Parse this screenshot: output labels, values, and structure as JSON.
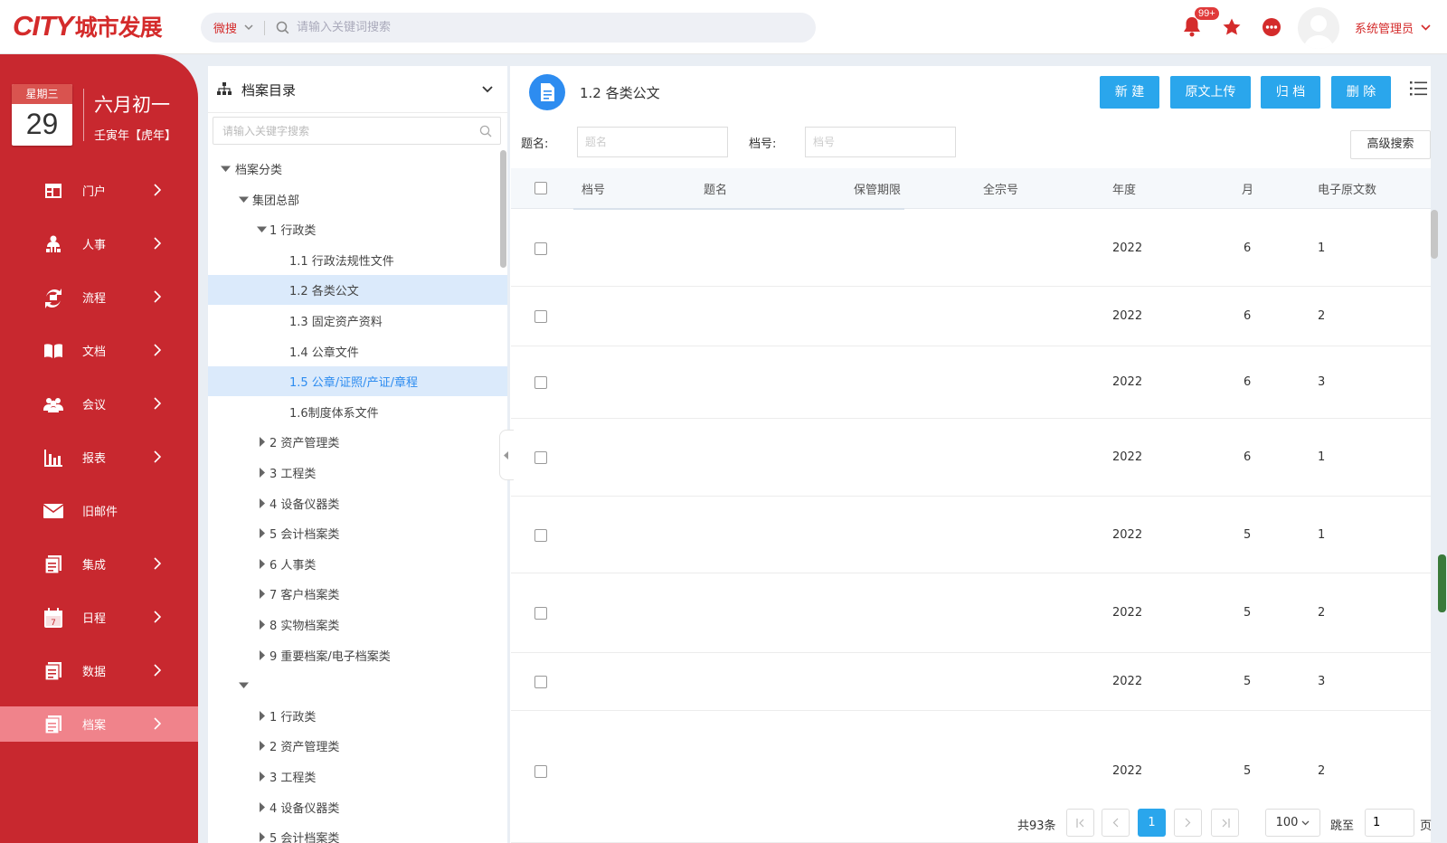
{
  "brand": {
    "logo_latin": "CITY",
    "logo_cn": "城市发展"
  },
  "search": {
    "scope": "微搜",
    "placeholder": "请输入关键词搜索"
  },
  "header": {
    "notif_count": "99+",
    "username": "系统管理员"
  },
  "calendar": {
    "weekday": "星期三",
    "day": "29",
    "lunar": "六月初一",
    "ganzhi": "壬寅年【虎年】"
  },
  "nav": [
    {
      "label": "门户",
      "icon": "portal-icon",
      "arrow": true
    },
    {
      "label": "人事",
      "icon": "people-icon",
      "arrow": true
    },
    {
      "label": "流程",
      "icon": "flow-icon",
      "arrow": true
    },
    {
      "label": "文档",
      "icon": "book-icon",
      "arrow": true
    },
    {
      "label": "会议",
      "icon": "meeting-icon",
      "arrow": true
    },
    {
      "label": "报表",
      "icon": "report-icon",
      "arrow": true
    },
    {
      "label": "旧邮件",
      "icon": "mail-icon",
      "arrow": false
    },
    {
      "label": "集成",
      "icon": "integration-icon",
      "arrow": true
    },
    {
      "label": "日程",
      "icon": "calendar-icon",
      "arrow": true
    },
    {
      "label": "数据",
      "icon": "data-icon",
      "arrow": true
    },
    {
      "label": "档案",
      "icon": "archive-icon",
      "arrow": true,
      "active": true
    }
  ],
  "tree": {
    "title": "档案目录",
    "search_placeholder": "请输入关键字搜索",
    "nodes": [
      {
        "label": "档案分类",
        "level": 0,
        "caret": "down"
      },
      {
        "label": "集团总部",
        "level": 1,
        "caret": "down"
      },
      {
        "label": "1 行政类",
        "level": 2,
        "caret": "down"
      },
      {
        "label": "1.1 行政法规性文件",
        "level": 3,
        "caret": "none"
      },
      {
        "label": "1.2 各类公文",
        "level": 3,
        "caret": "none",
        "state": "selected"
      },
      {
        "label": "1.3 固定资产资料",
        "level": 3,
        "caret": "none"
      },
      {
        "label": "1.4 公章文件",
        "level": 3,
        "caret": "none"
      },
      {
        "label": "1.5 公章/证照/产证/章程",
        "level": 3,
        "caret": "none",
        "state": "hover"
      },
      {
        "label": "1.6制度体系文件",
        "level": 3,
        "caret": "none"
      },
      {
        "label": "2 资产管理类",
        "level": 2,
        "caret": "right"
      },
      {
        "label": "3 工程类",
        "level": 2,
        "caret": "right"
      },
      {
        "label": "4 设备仪器类",
        "level": 2,
        "caret": "right"
      },
      {
        "label": "5 会计档案类",
        "level": 2,
        "caret": "right"
      },
      {
        "label": "6 人事类",
        "level": 2,
        "caret": "right"
      },
      {
        "label": "7 客户档案类",
        "level": 2,
        "caret": "right"
      },
      {
        "label": "8 实物档案类",
        "level": 2,
        "caret": "right"
      },
      {
        "label": "9 重要档案/电子档案类",
        "level": 2,
        "caret": "right"
      },
      {
        "label": "",
        "level": 1,
        "caret": "down"
      },
      {
        "label": "1 行政类",
        "level": 2,
        "caret": "right"
      },
      {
        "label": "2 资产管理类",
        "level": 2,
        "caret": "right"
      },
      {
        "label": "3 工程类",
        "level": 2,
        "caret": "right"
      },
      {
        "label": "4 设备仪器类",
        "level": 2,
        "caret": "right"
      },
      {
        "label": "5 会计档案类",
        "level": 2,
        "caret": "right"
      }
    ]
  },
  "main": {
    "title": "1.2 各类公文",
    "buttons": {
      "new": "新 建",
      "upload": "原文上传",
      "archive": "归 档",
      "delete": "删 除"
    },
    "filters": {
      "title_label": "题名:",
      "title_placeholder": "题名",
      "no_label": "档号:",
      "no_placeholder": "档号",
      "advanced": "高级搜索"
    },
    "columns": {
      "no": "档号",
      "title": "题名",
      "period": "保管期限",
      "fonds": "全宗号",
      "year": "年度",
      "month": "月",
      "count": "电子原文数"
    },
    "rows": [
      {
        "year": "2022",
        "month": "6",
        "count": "1"
      },
      {
        "year": "2022",
        "month": "6",
        "count": "2"
      },
      {
        "year": "2022",
        "month": "6",
        "count": "3"
      },
      {
        "year": "2022",
        "month": "6",
        "count": "1"
      },
      {
        "year": "2022",
        "month": "5",
        "count": "1"
      },
      {
        "year": "2022",
        "month": "5",
        "count": "2"
      },
      {
        "year": "2022",
        "month": "5",
        "count": "3"
      },
      {
        "year": "2022",
        "month": "5",
        "count": "2"
      }
    ],
    "pager": {
      "total": "共93条",
      "current": "1",
      "size": "100",
      "jump_label": "跳至",
      "jump_value": "1",
      "page_unit": "页"
    }
  },
  "colors": {
    "brand_red": "#c8282f",
    "accent_blue": "#2aa6ec",
    "active_nav": "#f0838b",
    "selected_row": "#dbeafb"
  }
}
